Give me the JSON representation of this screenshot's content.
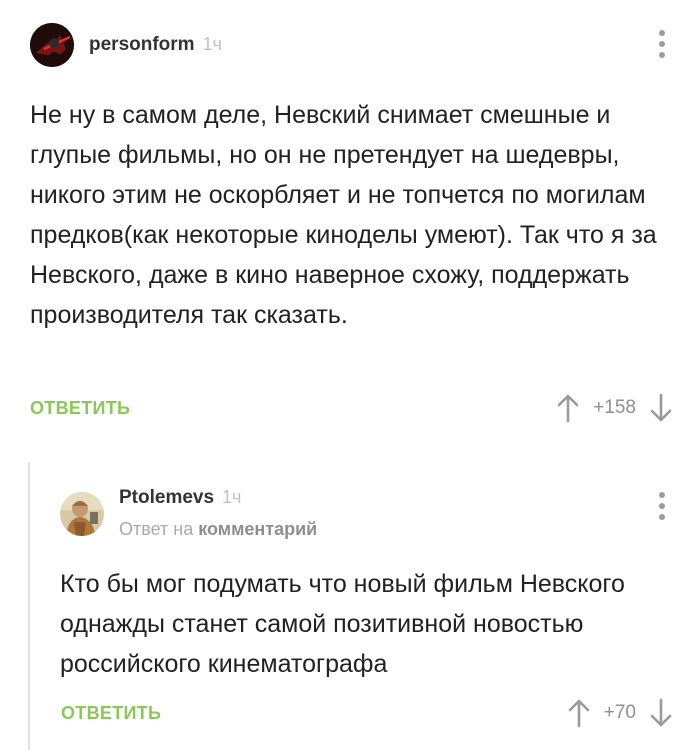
{
  "comments": [
    {
      "username": "personform",
      "time": "1ч",
      "text": "Не ну в самом деле, Невский снимает смешные и глупые фильмы, но он не претендует на шедевры, никого этим не оскорбляет и не топчется по могилам предков(как некоторые киноделы умеют). Так что я за Невского, даже в кино наверное схожу, поддержать производителя так сказать.",
      "reply_label": "ОТВЕТИТЬ",
      "rating": "+158"
    },
    {
      "username": "Ptolemevs",
      "time": "1ч",
      "reply_prefix": "Ответ на",
      "reply_target": "комментарий",
      "text": "Кто бы мог подумать что новый фильм Невского однажды станет самой позитивной новостью российского кинематографа",
      "reply_label": "ОТВЕТИТЬ",
      "rating": "+70"
    }
  ],
  "colors": {
    "reply_green": "#8ac858",
    "meta_gray": "#c2c2c2",
    "thread_line": "#e2e2e2"
  }
}
